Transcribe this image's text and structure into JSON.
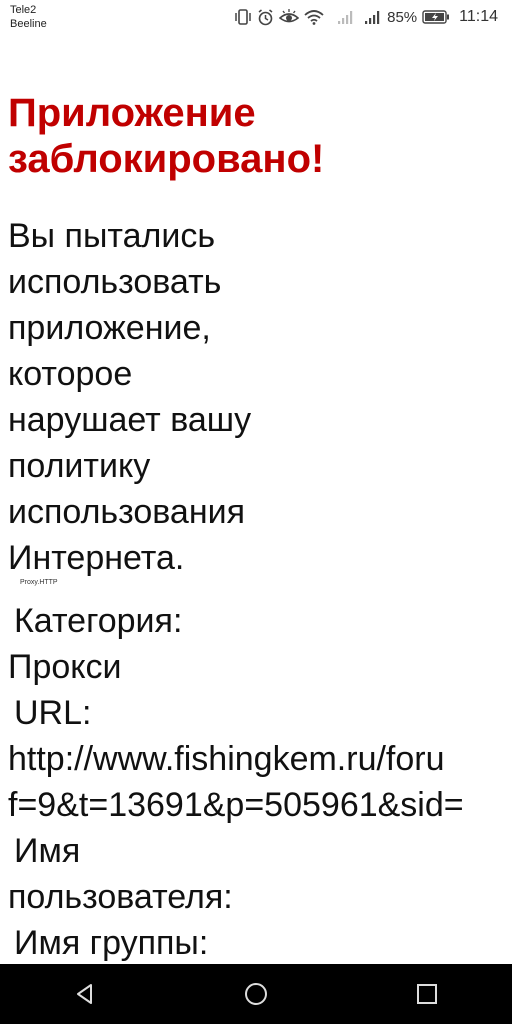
{
  "status_bar": {
    "carrier_1": "Tele2",
    "carrier_2": "Beeline",
    "battery": "85%",
    "time": "11:14",
    "icons": [
      "vibrate-icon",
      "alarm-icon",
      "eye-comfort-icon",
      "wifi-icon",
      "signal-icon-sim1",
      "signal-icon-sim2",
      "battery-icon"
    ]
  },
  "page": {
    "title_line1": "Приложение",
    "title_line2": "заблокировано!",
    "message_lines": [
      "Вы пытались",
      "использовать",
      "приложение,",
      "которое",
      "нарушает вашу",
      "политику",
      "использования",
      "Интернета."
    ],
    "proxy_tag": "Proxy.HTTP",
    "category_label": "Категория:",
    "category_value": "Прокси",
    "url_label": "URL:",
    "url_line1": "http://www.fishingkem.ru/foru",
    "url_line2": "f=9&t=13691&p=505961&sid=",
    "username_label_line1": "Имя",
    "username_label_line2": "пользователя:",
    "group_label": "Имя группы:"
  },
  "colors": {
    "title": "#c00000",
    "text": "#111111",
    "nav_bar": "#000000"
  },
  "nav_bar": {
    "icons": [
      "back-icon",
      "home-icon",
      "recents-icon"
    ]
  }
}
